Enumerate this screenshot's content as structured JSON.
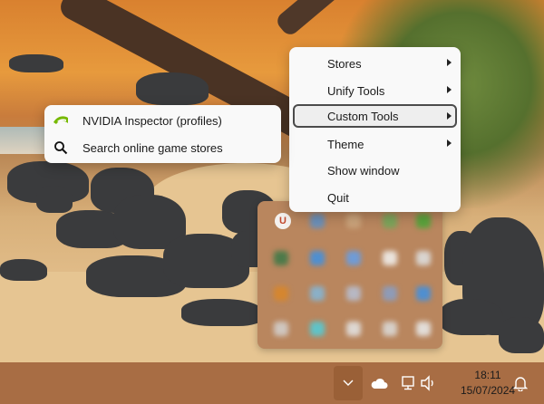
{
  "context_menu": {
    "items": [
      {
        "label": "Stores",
        "has_submenu": true
      },
      {
        "label": "Unify Tools",
        "has_submenu": true
      },
      {
        "label": "Custom Tools",
        "has_submenu": true,
        "focused": true
      },
      {
        "label": "Theme",
        "has_submenu": true
      },
      {
        "label": "Show window",
        "has_submenu": false
      },
      {
        "label": "Quit",
        "has_submenu": false
      }
    ]
  },
  "submenu": {
    "items": [
      {
        "label": "NVIDIA Inspector (profiles)",
        "icon": "nvidia-icon"
      },
      {
        "label": "Search online game stores",
        "icon": "search-icon"
      }
    ]
  },
  "tray_flyout": {
    "first_icon_letter": "U"
  },
  "taskbar": {
    "icons": [
      "chevron-up-icon",
      "onedrive-cloud-icon",
      "network-icon",
      "volume-icon",
      "notifications-bell-icon"
    ],
    "time": "18:11",
    "date": "15/07/2024"
  },
  "colors": {
    "taskbar": "#a86d44",
    "menu_bg": "#f9f9f9",
    "focus_border": "#4b4b4b",
    "nvidia_green": "#76b900"
  }
}
